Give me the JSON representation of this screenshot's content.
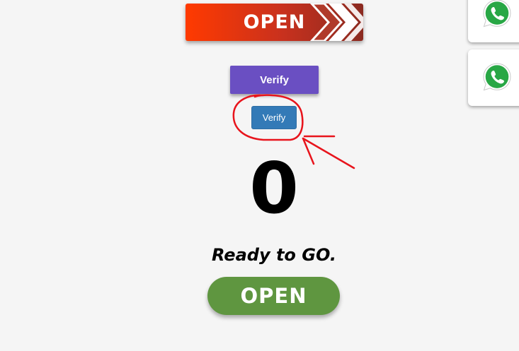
{
  "banner": {
    "label": "OPEN"
  },
  "verify_primary": {
    "label": "Verify",
    "color": "#6a4fc2"
  },
  "verify_secondary": {
    "label": "Verify",
    "color": "#337ab7"
  },
  "counter": {
    "value": "0"
  },
  "status": {
    "text": "Ready to GO."
  },
  "open_pill": {
    "label": "OPEN",
    "color": "#5f9640"
  },
  "side_buttons": [
    {
      "icon": "whatsapp-icon"
    },
    {
      "icon": "whatsapp-icon"
    }
  ],
  "annotation": {
    "color": "#e8141c"
  }
}
